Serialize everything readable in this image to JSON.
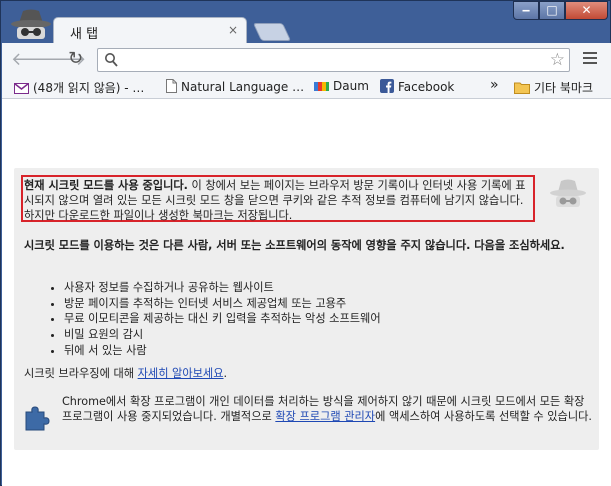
{
  "tab": {
    "title": "새 탭",
    "close": "×"
  },
  "window": {
    "minimize": "‒",
    "maximize": "□",
    "close": "✕"
  },
  "toolbar": {
    "omnibox_value": "",
    "omnibox_placeholder": ""
  },
  "bookmarks": [
    {
      "label": "(48개 읽지 않음) - …",
      "icon": "gmail-icon"
    },
    {
      "label": "Natural Language …",
      "icon": "page-icon"
    },
    {
      "label": "Daum",
      "icon": "daum-icon"
    },
    {
      "label": "Facebook",
      "icon": "facebook-icon"
    }
  ],
  "bookmarks_more": "»",
  "bookmarks_other": "기타 북마크",
  "incognito": {
    "intro_bold": "현재 시크릿 모드를 사용 중입니다.",
    "intro_rest": " 이 창에서 보는 페이지는 브라우저 방문 기록이나 인터넷 사용 기록에 표시되지 않으며 열려 있는 모든 시크릿 모드 창을 닫으면 쿠키와 같은 추적 정보를 컴퓨터에 남기지 않습니다. 하지만 다운로드한 파일이나 생성한 북마크는 저장됩니다.",
    "caution": "시크릿 모드를 이용하는 것은 다른 사람, 서버 또는 소프트웨어의 동작에 영향을 주지 않습니다. 다음을 조심하세요.",
    "list": [
      "사용자 정보를 수집하거나 공유하는 웹사이트",
      "방문 페이지를 추적하는 인터넷 서비스 제공업체 또는 고용주",
      "무료 이모티콘을 제공하는 대신 키 입력을 추적하는 악성 소프트웨어",
      "비밀 요원의 감시",
      "뒤에 서 있는 사람"
    ],
    "learn_prefix": "시크릿 브라우징에 대해 ",
    "learn_link": "자세히 알아보세요",
    "learn_suffix": ".",
    "ext_prefix": "Chrome에서 확장 프로그램이 개인 데이터를 처리하는 방식을 제어하지 않기 때문에 시크릿 모드에서 모든 확장 프로그램이 사용 중지되었습니다. 개별적으로 ",
    "ext_link": "확장 프로그램 관리자",
    "ext_suffix": "에 액세스하여 사용하도록 선택할 수 있습니다."
  },
  "colors": {
    "frame": "#3e5f98",
    "highlight": "#d8232a",
    "link": "#1e48b4",
    "panel": "#eeeeee"
  }
}
